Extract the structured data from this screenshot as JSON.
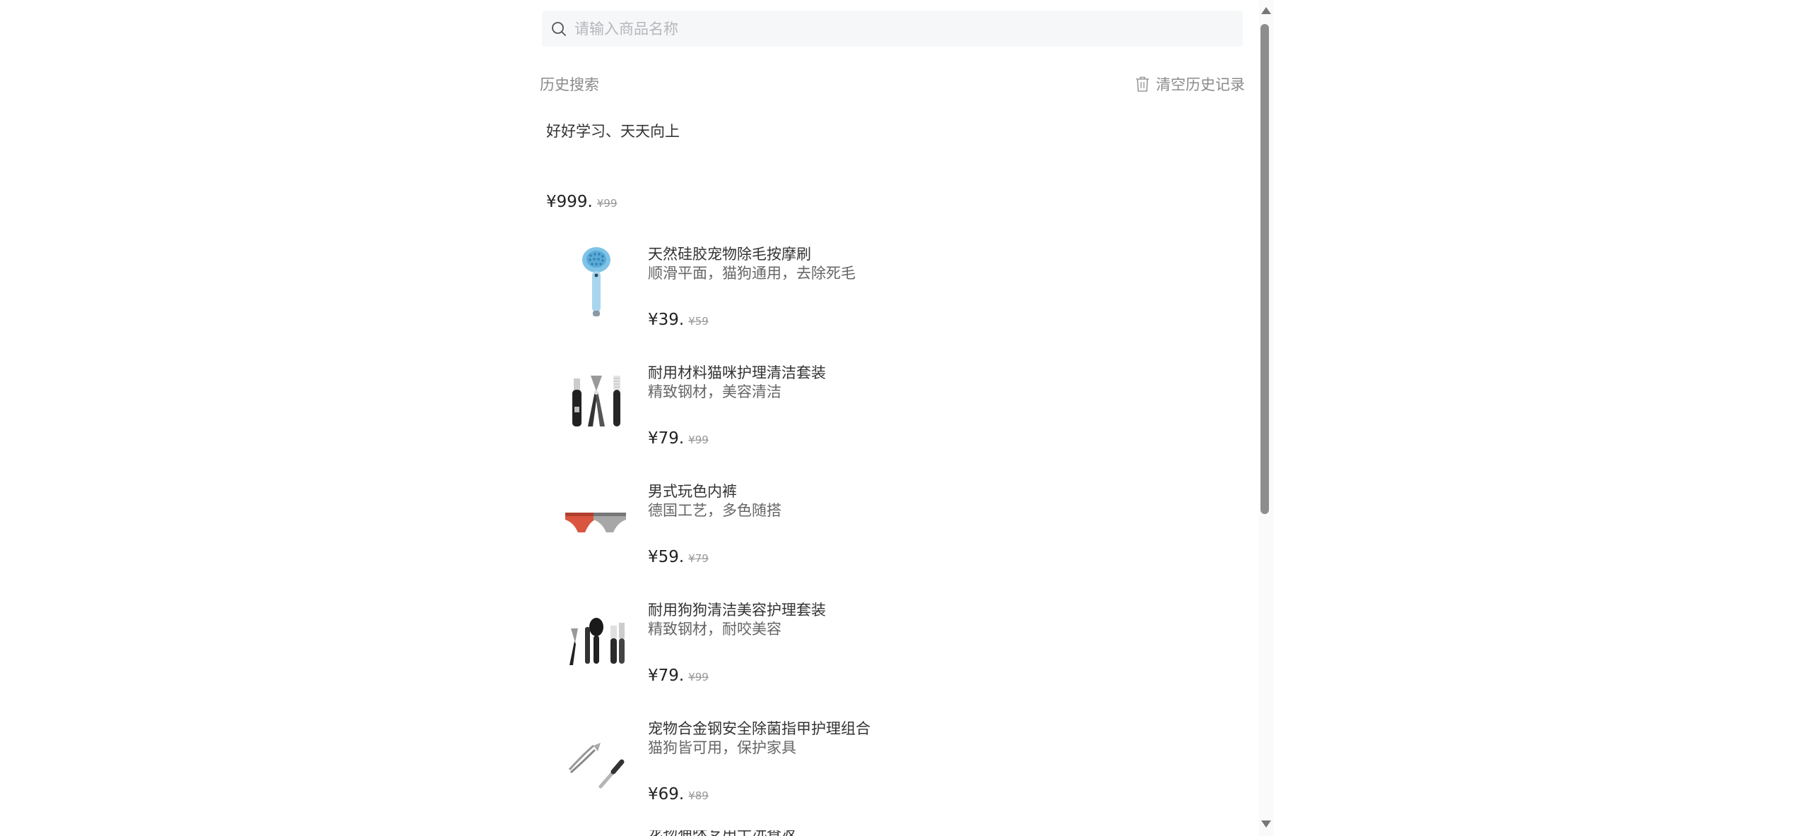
{
  "search": {
    "placeholder": "请输入商品名称",
    "icon": "search-icon"
  },
  "history": {
    "title": "历史搜索",
    "clear_label": "清空历史记录",
    "clear_icon": "trash-icon",
    "tags": [
      "好好学习、天天向上"
    ]
  },
  "featured": {
    "price": "¥999.",
    "original_price": "¥99"
  },
  "products": [
    {
      "name": "天然硅胶宠物除毛按摩刷",
      "desc": "顺滑平面，猫狗通用，去除死毛",
      "price": "¥39.",
      "original_price": "¥59",
      "image": "pet-brush-image"
    },
    {
      "name": "耐用材料猫咪护理清洁套装",
      "desc": "精致钢材，美容清洁",
      "price": "¥79.",
      "original_price": "¥99",
      "image": "cat-grooming-kit-image"
    },
    {
      "name": "男式玩色内裤",
      "desc": "德国工艺，多色随搭",
      "price": "¥59.",
      "original_price": "¥79",
      "image": "mens-underwear-image"
    },
    {
      "name": "耐用狗狗清洁美容护理套装",
      "desc": "精致钢材，耐咬美容",
      "price": "¥79.",
      "original_price": "¥99",
      "image": "dog-grooming-kit-image"
    },
    {
      "name": "宠物合金钢安全除菌指甲护理组合",
      "desc": "猫狗皆可用，保护家具",
      "price": "¥69.",
      "original_price": "¥89",
      "image": "nail-care-set-image"
    }
  ],
  "partial_item_name": "宠物猫咪专用干洗香波"
}
